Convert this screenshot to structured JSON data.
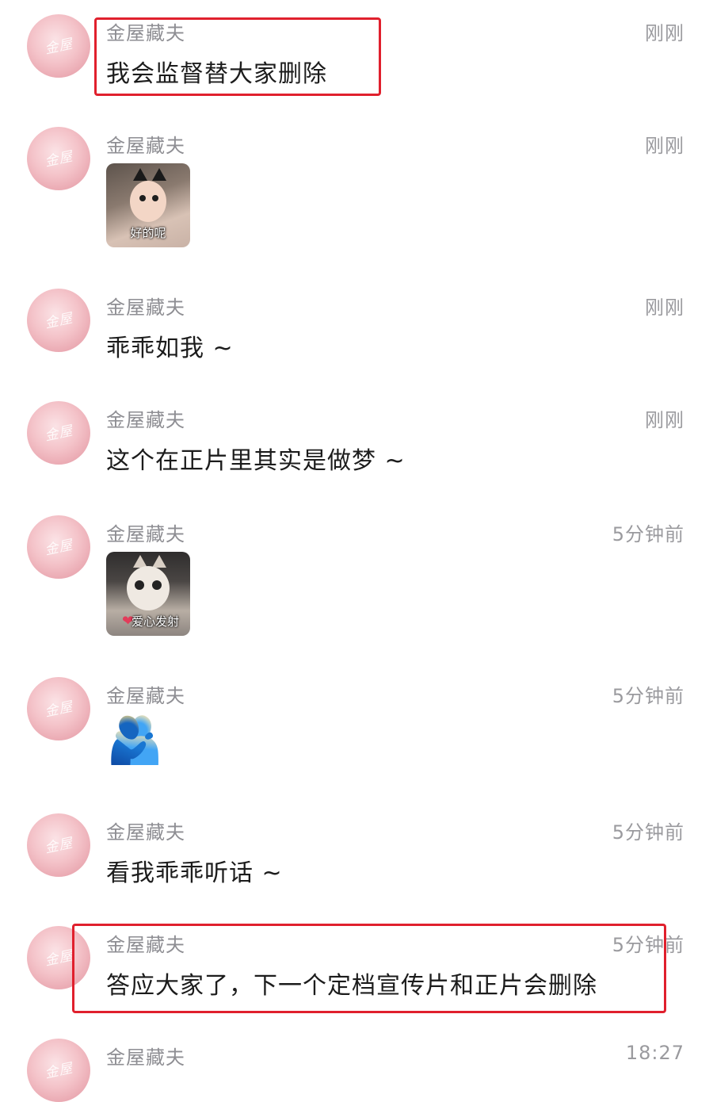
{
  "messages": [
    {
      "author": "金屋藏夫",
      "time": "刚刚",
      "type": "text",
      "text": "我会监督替大家删除",
      "highlighted": true
    },
    {
      "author": "金屋藏夫",
      "time": "刚刚",
      "type": "sticker",
      "sticker": "girl-cat-ears",
      "caption": "好的呢"
    },
    {
      "author": "金屋藏夫",
      "time": "刚刚",
      "type": "text",
      "text": "乖乖如我 ~"
    },
    {
      "author": "金屋藏夫",
      "time": "刚刚",
      "type": "text",
      "text": "这个在正片里其实是做梦 ~"
    },
    {
      "author": "金屋藏夫",
      "time": "5分钟前",
      "type": "sticker",
      "sticker": "cat-heart",
      "caption": "爱心发射"
    },
    {
      "author": "金屋藏夫",
      "time": "5分钟前",
      "type": "emoji",
      "emoji": "🫂",
      "emoji_name": "hug-emoji"
    },
    {
      "author": "金屋藏夫",
      "time": "5分钟前",
      "type": "text",
      "text": "看我乖乖听话 ~"
    },
    {
      "author": "金屋藏夫",
      "time": "5分钟前",
      "type": "text",
      "text": "答应大家了，下一个定档宣传片和正片会删除",
      "highlighted": true
    },
    {
      "author": "金屋藏夫",
      "time": "18:27",
      "type": "text",
      "text": ""
    }
  ],
  "avatar": {
    "signature": "金屋藏夫",
    "colors": {
      "base": "#f4c3c9",
      "light": "#fbe3e6"
    }
  },
  "highlight_color": "#e0202d"
}
